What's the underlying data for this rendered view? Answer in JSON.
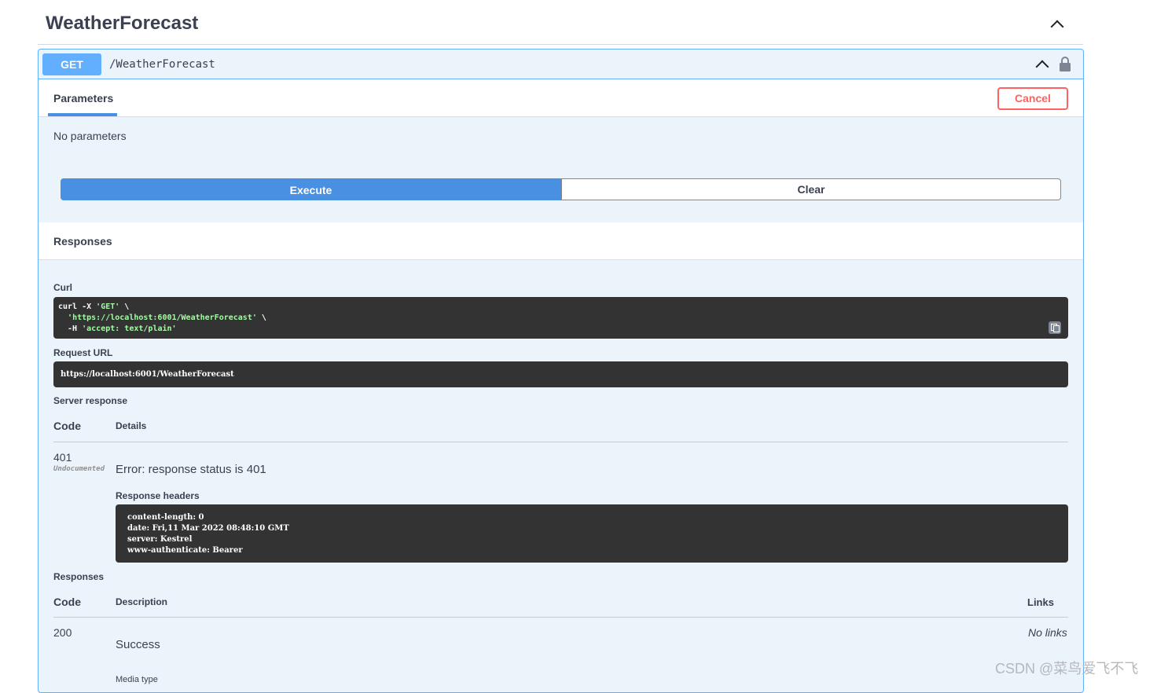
{
  "tag": {
    "title": "WeatherForecast"
  },
  "operation": {
    "method": "GET",
    "path": "/WeatherForecast"
  },
  "tabs": {
    "parameters": "Parameters",
    "cancel": "Cancel"
  },
  "parameters": {
    "empty_text": "No parameters"
  },
  "actions": {
    "execute": "Execute",
    "clear": "Clear"
  },
  "responses_section": {
    "title": "Responses",
    "curl_label": "Curl",
    "curl_lines": [
      {
        "pre": "curl -X ",
        "str": "'GET'",
        "post": " \\"
      },
      {
        "pre": "  ",
        "str": "'https://localhost:6001/WeatherForecast'",
        "post": " \\"
      },
      {
        "pre": "  -H ",
        "str": "'accept: text/plain'",
        "post": ""
      }
    ],
    "request_url_label": "Request URL",
    "request_url": "https://localhost:6001/WeatherForecast",
    "server_response_label": "Server response",
    "columns": {
      "code": "Code",
      "details": "Details"
    },
    "server_row": {
      "code": "401",
      "tag": "Undocumented",
      "detail": "Error: response status is 401",
      "headers_label": "Response headers",
      "headers": [
        "content-length: 0",
        "date: Fri,11 Mar 2022 08:48:10 GMT",
        "server: Kestrel",
        "www-authenticate: Bearer"
      ]
    },
    "responses_label": "Responses",
    "doc_columns": {
      "code": "Code",
      "description": "Description",
      "links": "Links"
    },
    "doc_row": {
      "code": "200",
      "description": "Success",
      "links": "No links",
      "media_type_label": "Media type"
    }
  },
  "watermark": "CSDN @菜鸟爱飞不飞",
  "icons": {
    "collapse": "chevron-up-icon",
    "lock": "lock-icon",
    "copy": "copy-icon"
  },
  "colors": {
    "get_blue": "#61affe",
    "execute_blue": "#4990e2",
    "cancel_red": "#ff6060",
    "block_bg": "#ebf3fb",
    "code_bg": "#333333"
  }
}
